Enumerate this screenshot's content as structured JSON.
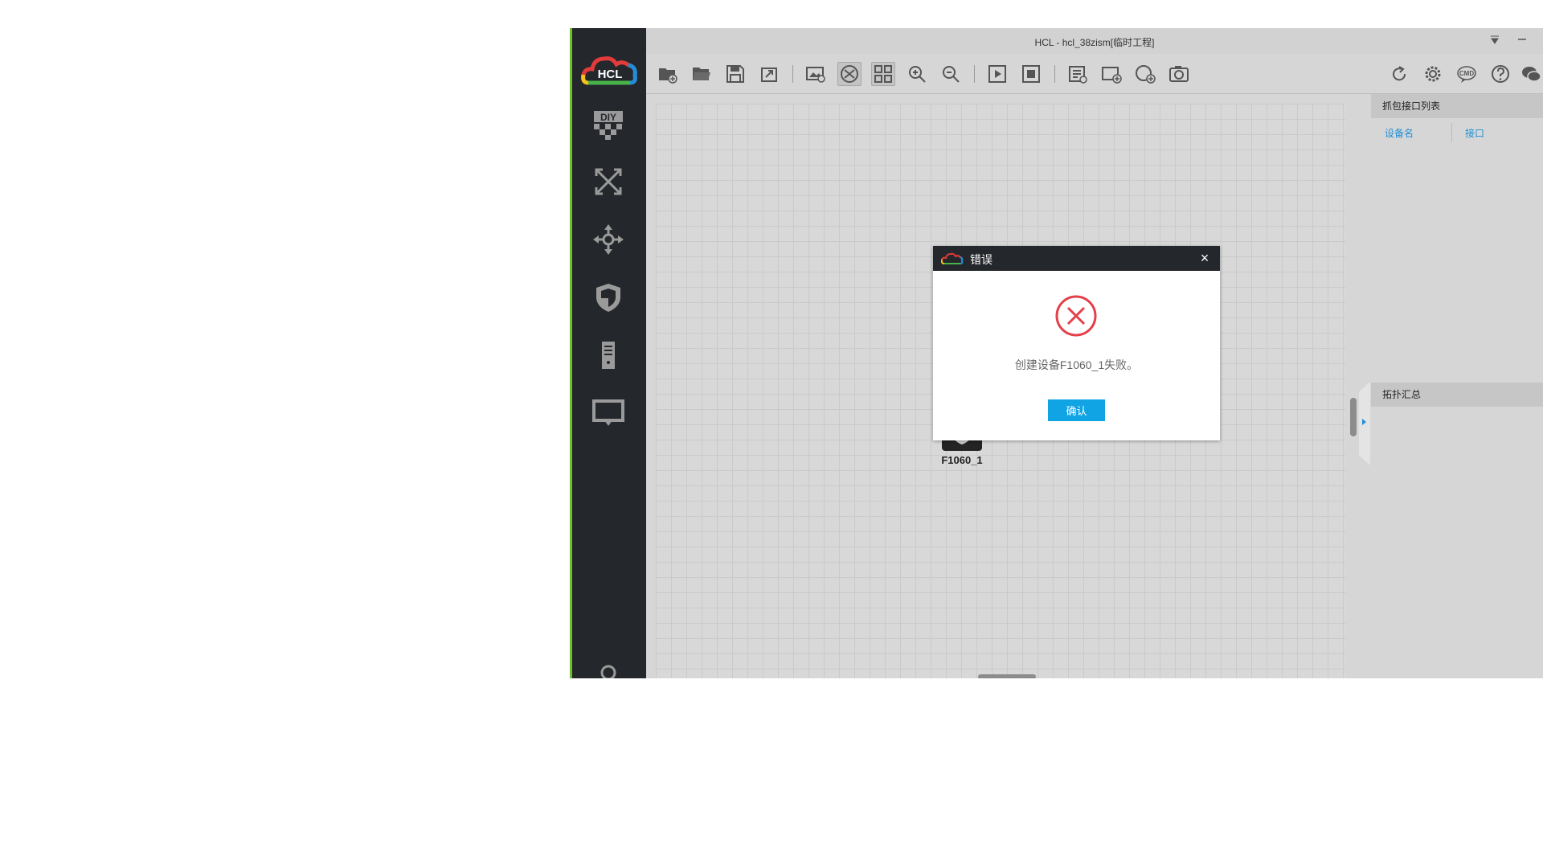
{
  "window": {
    "title": "HCL - hcl_38zism[临时工程]",
    "controls": [
      "menu-down-icon",
      "minimize-icon"
    ]
  },
  "sidebar": {
    "logo_text": "HCL",
    "items": [
      {
        "name": "diy",
        "icon": "diy-icon"
      },
      {
        "name": "switch",
        "icon": "switch-arrows-icon"
      },
      {
        "name": "router",
        "icon": "router-arrows-icon"
      },
      {
        "name": "security",
        "icon": "shield-icon"
      },
      {
        "name": "terminal",
        "icon": "pc-tower-icon"
      },
      {
        "name": "connection",
        "icon": "monitor-icon"
      }
    ]
  },
  "toolbar": {
    "left_icons": [
      "new-project-icon",
      "open-folder-icon",
      "save-icon",
      "export-icon",
      "import-image-icon",
      "topology-view-icon",
      "grid-view-icon",
      "zoom-in-icon",
      "zoom-out-icon",
      "start-all-icon",
      "stop-all-icon",
      "text-note-icon",
      "add-rect-icon",
      "add-ellipse-icon",
      "screenshot-icon"
    ],
    "active_icons": [
      "topology-view-icon",
      "grid-view-icon"
    ],
    "right_icons": [
      "refresh-icon",
      "settings-icon",
      "cmd-icon",
      "help-icon",
      "wechat-icon"
    ],
    "cmd_label": "CMD"
  },
  "canvas": {
    "devices": [
      {
        "label": "F1060_1",
        "icon": "firewall-shield-icon"
      }
    ]
  },
  "right_panel": {
    "capture_title": "抓包接口列表",
    "col_device": "设备名",
    "col_interface": "接口",
    "topology_title": "拓扑汇总"
  },
  "dialog": {
    "title": "错误",
    "message": "创建设备F1060_1失败。",
    "ok_label": "确认",
    "close_glyph": "×",
    "icon": "error-x-circle-icon"
  },
  "colors": {
    "sidebar_bg": "#24272b",
    "sidebar_accent": "#6fbf2a",
    "link_blue": "#1e8fd8",
    "ok_button": "#10a4e4",
    "error_red": "#e5404a"
  }
}
